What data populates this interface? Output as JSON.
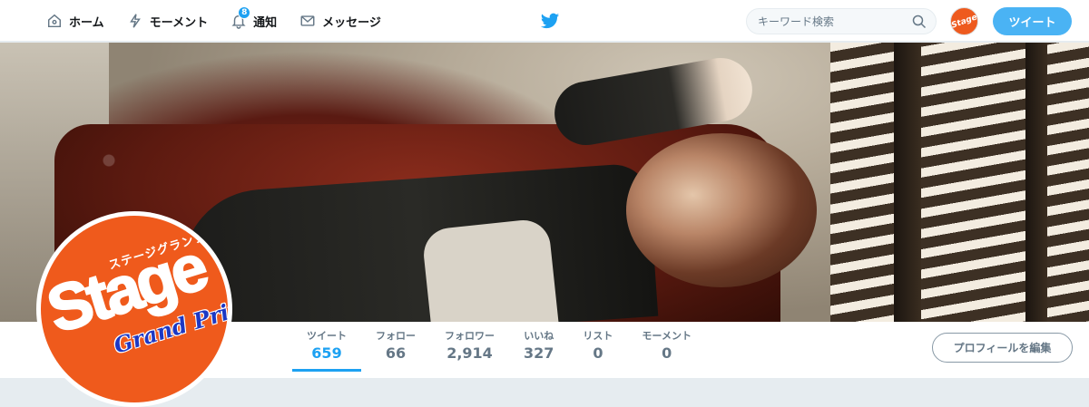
{
  "nav": {
    "items": [
      {
        "label": "ホーム",
        "icon": "home-icon"
      },
      {
        "label": "モーメント",
        "icon": "lightning-icon"
      },
      {
        "label": "通知",
        "icon": "bell-icon",
        "badge": "8"
      },
      {
        "label": "メッセージ",
        "icon": "envelope-icon"
      }
    ],
    "search_placeholder": "キーワード検索",
    "tweet_label": "ツイート",
    "account_avatar_text": "Stage"
  },
  "profile": {
    "avatar": {
      "kana": "ステージグランプリ",
      "word": "Stage",
      "sub": "Grand Prix"
    },
    "stats": [
      {
        "label": "ツイート",
        "value": "659",
        "active": true
      },
      {
        "label": "フォロー",
        "value": "66"
      },
      {
        "label": "フォロワー",
        "value": "2,914"
      },
      {
        "label": "いいね",
        "value": "327"
      },
      {
        "label": "リスト",
        "value": "0"
      },
      {
        "label": "モーメント",
        "value": "0"
      }
    ],
    "edit_label": "プロフィールを編集"
  },
  "colors": {
    "accent": "#1da1f2",
    "tweet_button": "#4ab3f4",
    "brand_orange": "#ef5a1c",
    "logo_blue": "#1d38c4"
  }
}
